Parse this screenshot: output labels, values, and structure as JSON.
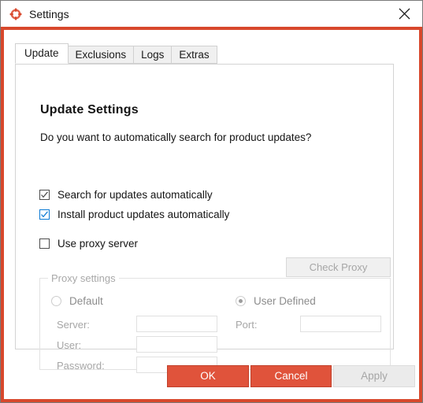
{
  "window": {
    "title": "Settings",
    "app_icon": "target-crosshair-icon",
    "close_icon": "close-icon",
    "accent_color": "#d8482c",
    "button_color": "#e0533b"
  },
  "tabs": [
    {
      "label": "Update",
      "active": true
    },
    {
      "label": "Exclusions",
      "active": false
    },
    {
      "label": "Logs",
      "active": false
    },
    {
      "label": "Extras",
      "active": false
    }
  ],
  "panel": {
    "title": "Update Settings",
    "question": "Do you want to automatically search for product updates?",
    "checkboxes": [
      {
        "label": "Search for updates automatically",
        "checked": true,
        "style": "dark"
      },
      {
        "label": "Install product updates automatically",
        "checked": true,
        "style": "blue"
      },
      {
        "label": "Use proxy server",
        "checked": false,
        "style": "dark"
      }
    ],
    "check_proxy_button": {
      "label": "Check Proxy",
      "disabled": true
    }
  },
  "proxy_settings": {
    "legend": "Proxy settings",
    "radios": [
      {
        "label": "Default",
        "selected": false
      },
      {
        "label": "User Defined",
        "selected": true
      }
    ],
    "fields": [
      {
        "label": "Server:",
        "value": "",
        "placeholder": ""
      },
      {
        "label": "User:",
        "value": "",
        "placeholder": ""
      },
      {
        "label": "Password:",
        "value": "",
        "placeholder": ""
      },
      {
        "label": "Port:",
        "value": "",
        "placeholder": ""
      }
    ]
  },
  "footer": {
    "ok_label": "OK",
    "cancel_label": "Cancel",
    "apply_label": "Apply",
    "apply_disabled": true
  }
}
